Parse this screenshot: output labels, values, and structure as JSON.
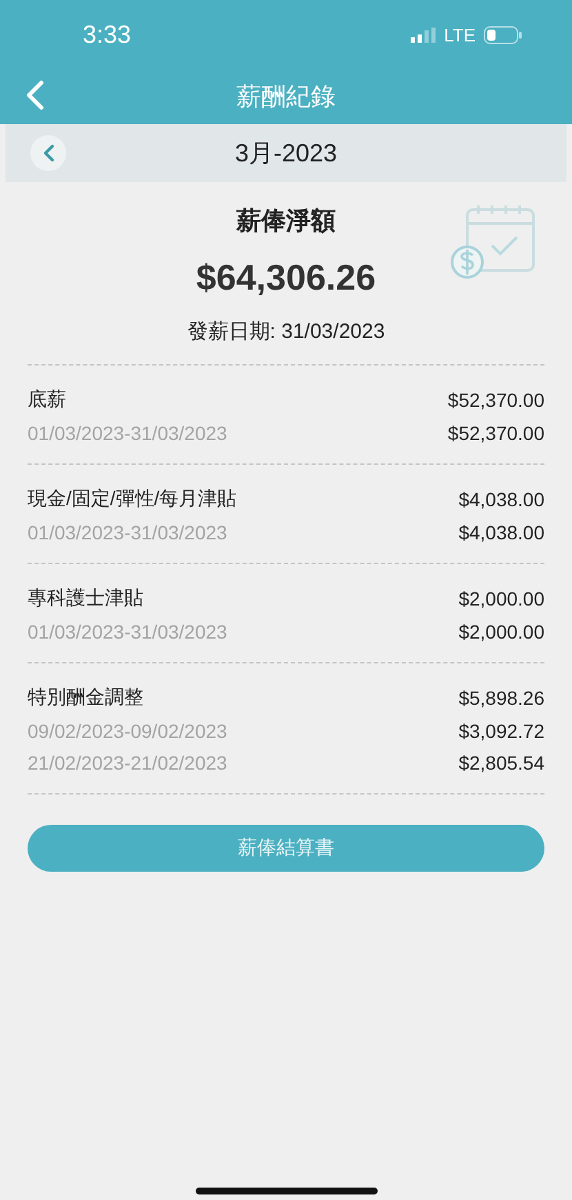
{
  "status_bar": {
    "time": "3:33",
    "network": "LTE"
  },
  "nav": {
    "title": "薪酬紀錄"
  },
  "month_bar": {
    "label": "3月-2023"
  },
  "summary": {
    "title": "薪俸淨額",
    "amount": "$64,306.26",
    "pay_date": "發薪日期: 31/03/2023"
  },
  "sections": [
    {
      "title": "底薪",
      "amount": "$52,370.00",
      "lines": [
        {
          "period": "01/03/2023-31/03/2023",
          "amount": "$52,370.00"
        }
      ]
    },
    {
      "title": "現金/固定/彈性/每月津貼",
      "amount": "$4,038.00",
      "lines": [
        {
          "period": "01/03/2023-31/03/2023",
          "amount": "$4,038.00"
        }
      ]
    },
    {
      "title": "專科護士津貼",
      "amount": "$2,000.00",
      "lines": [
        {
          "period": "01/03/2023-31/03/2023",
          "amount": "$2,000.00"
        }
      ]
    },
    {
      "title": "特別酬金調整",
      "amount": "$5,898.26",
      "lines": [
        {
          "period": "09/02/2023-09/02/2023",
          "amount": "$3,092.72"
        },
        {
          "period": "21/02/2023-21/02/2023",
          "amount": "$2,805.54"
        }
      ]
    }
  ],
  "button": {
    "label": "薪俸結算書"
  }
}
